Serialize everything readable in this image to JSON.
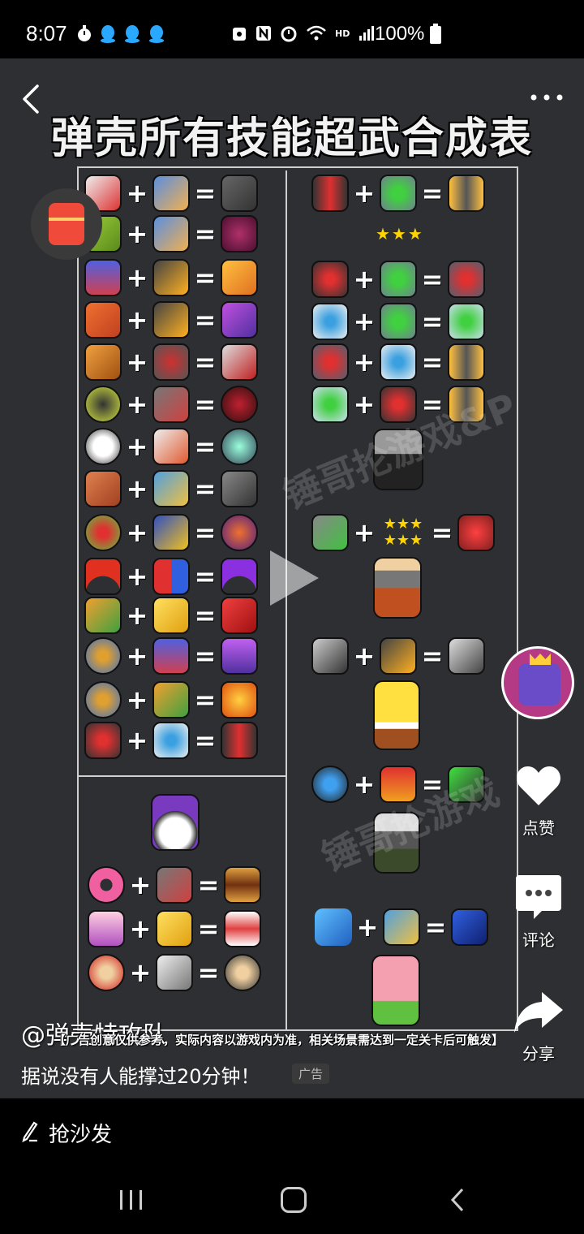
{
  "status_bar": {
    "time": "8:07",
    "battery_text": "100%",
    "hd_label": "HD"
  },
  "video": {
    "title": "弹壳所有技能超武合成表",
    "watermark_1": "锤哥抡游戏&P",
    "watermark_2": "锤哥抡游戏"
  },
  "overlay": {
    "author": "@弹壳特攻队",
    "disclaimer": "【广告创意仅供参考，实际内容以游戏内为准，相关场景需达到一定关卡后可触发】",
    "caption": "据说没有人能撑过20分钟！",
    "ad_label": "广告"
  },
  "side_actions": {
    "like_label": "点赞",
    "comment_label": "评论",
    "share_label": "分享"
  },
  "comment_bar": {
    "placeholder": "抢沙发"
  },
  "recipes": {
    "plus": "+",
    "equals": "=",
    "stars": "★★★"
  },
  "icon_colors": {
    "accent_red": "#e84a3c",
    "accent_blue": "#3a7fd0",
    "accent_yellow": "#ffd400"
  }
}
